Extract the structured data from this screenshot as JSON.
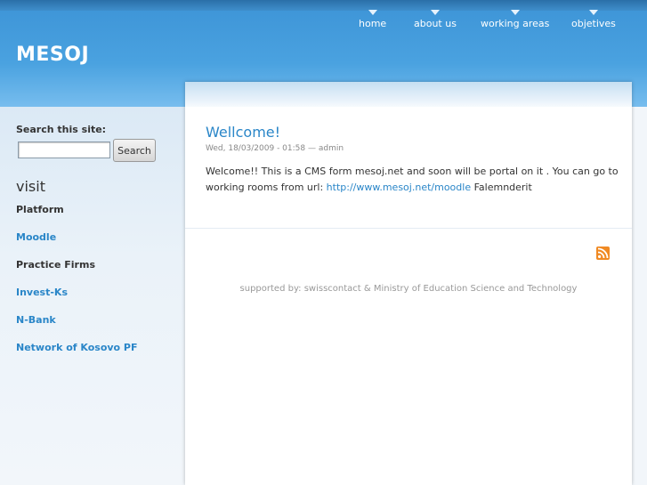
{
  "site": {
    "title": "MESOJ"
  },
  "nav": {
    "items": [
      {
        "label": "home"
      },
      {
        "label": "about us"
      },
      {
        "label": "working areas"
      },
      {
        "label": "objetives"
      }
    ]
  },
  "sidebar": {
    "search_label": "Search this site:",
    "search_value": "",
    "search_button": "Search",
    "visit_heading": "visit",
    "links": [
      {
        "label": "Platform",
        "color": "#333333"
      },
      {
        "label": "Moodle",
        "color": "#2a86c8"
      },
      {
        "label": "Practice Firms",
        "color": "#333333"
      },
      {
        "label": "Invest-Ks",
        "color": "#2a86c8"
      },
      {
        "label": "N-Bank",
        "color": "#2a86c8"
      },
      {
        "label": "Network of Kosovo PF",
        "color": "#2a86c8"
      }
    ]
  },
  "post": {
    "title": "Wellcome!",
    "meta": "Wed, 18/03/2009 - 01:58 — admin",
    "body_prefix": "Welcome!! This is a CMS form mesoj.net and soon will be portal on it . You can go to working rooms from url: ",
    "link_text": "http://www.mesoj.net/moodle",
    "body_suffix": " Falemnderit"
  },
  "footer": {
    "feed_icon": "rss-icon",
    "text": "supported by: swisscontact & Ministry of Education Science and Technology"
  },
  "colors": {
    "header_blue": "#4aa2e0",
    "link_blue": "#2a86c8",
    "rss_orange": "#f08a24"
  }
}
